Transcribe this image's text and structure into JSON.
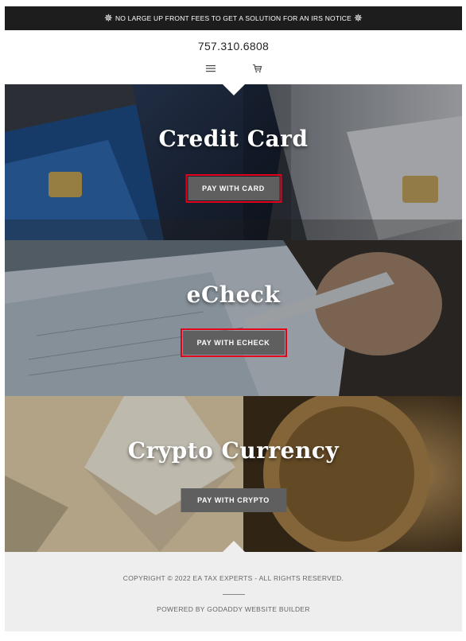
{
  "announcement": {
    "text": "NO LARGE UP FRONT FEES TO GET A SOLUTION FOR AN IRS NOTICE",
    "icon_left": "compass-star-icon",
    "icon_right": "compass-star-icon"
  },
  "header": {
    "phone": "757.310.6808",
    "menu_icon": "hamburger-menu-icon",
    "cart_icon": "cart-icon"
  },
  "sections": [
    {
      "title": "Credit Card",
      "button_label": "PAY WITH CARD",
      "highlighted": true
    },
    {
      "title": "eCheck",
      "button_label": "PAY WITH ECHECK",
      "highlighted": true
    },
    {
      "title": "Crypto Currency",
      "button_label": "PAY WITH CRYPTO",
      "highlighted": false
    }
  ],
  "footer": {
    "copyright": "COPYRIGHT © 2022 EA TAX EXPERTS - ALL RIGHTS RESERVED.",
    "powered_by": "POWERED BY GODADDY WEBSITE BUILDER"
  },
  "colors": {
    "announcement_bg": "#1d1d1d",
    "button_bg": "#5f5f5f",
    "highlight_outline": "#e3001b",
    "footer_bg": "#eeeeee"
  }
}
